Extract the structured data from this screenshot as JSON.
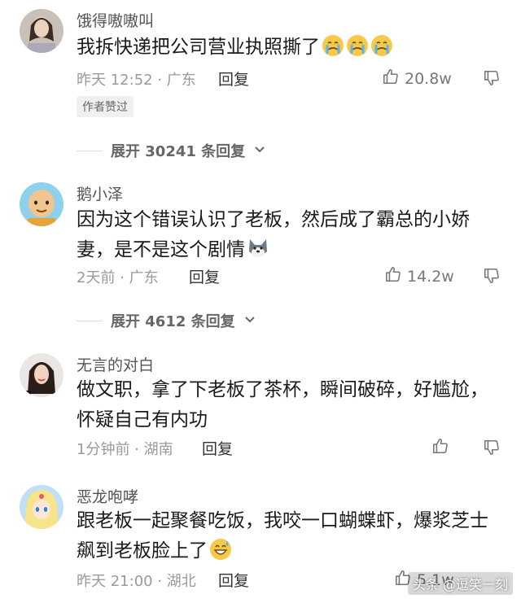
{
  "comments": [
    {
      "name": "饿得嗷嗷叫",
      "text": "我拆快递把公司营业执照撕了",
      "emoji": "crying-face-icon",
      "time_location": "昨天 12:52 · 广东",
      "reply_label": "回复",
      "likes": "20.8w",
      "badge": "作者赞过",
      "expand_label": "展开 30241 条回复"
    },
    {
      "name": "鹅小泽",
      "text_line1": "因为这个错误认识了老板，然后成了霸总的小娇",
      "text_line2": "妻，是不是这个剧情",
      "emoji": "husky-face-icon",
      "time_location": "2天前 · 广东",
      "reply_label": "回复",
      "likes": "14.2w",
      "expand_label": "展开 4612 条回复"
    },
    {
      "name": "无言的对白",
      "text_line1": "做文职，拿了下老板了茶杯，瞬间破碎，好尴尬，",
      "text_line2": "怀疑自己有内功",
      "time_location": "1分钟前 · 湖南",
      "reply_label": "回复"
    },
    {
      "name": "恶龙咆哮",
      "text_line1": "跟老板一起聚餐吃饭，我咬一口蝴蝶虾，爆浆芝士",
      "text_line2": "飙到老板脸上了",
      "emoji": "sweat-grin-icon",
      "time_location": "昨天 21:00 · 湖北",
      "reply_label": "回复",
      "likes": "5.1w"
    }
  ],
  "watermark": "头条 @逗笑一刻",
  "colors": {
    "text": "#1a1a1a",
    "meta": "#999999",
    "name": "#555555"
  }
}
